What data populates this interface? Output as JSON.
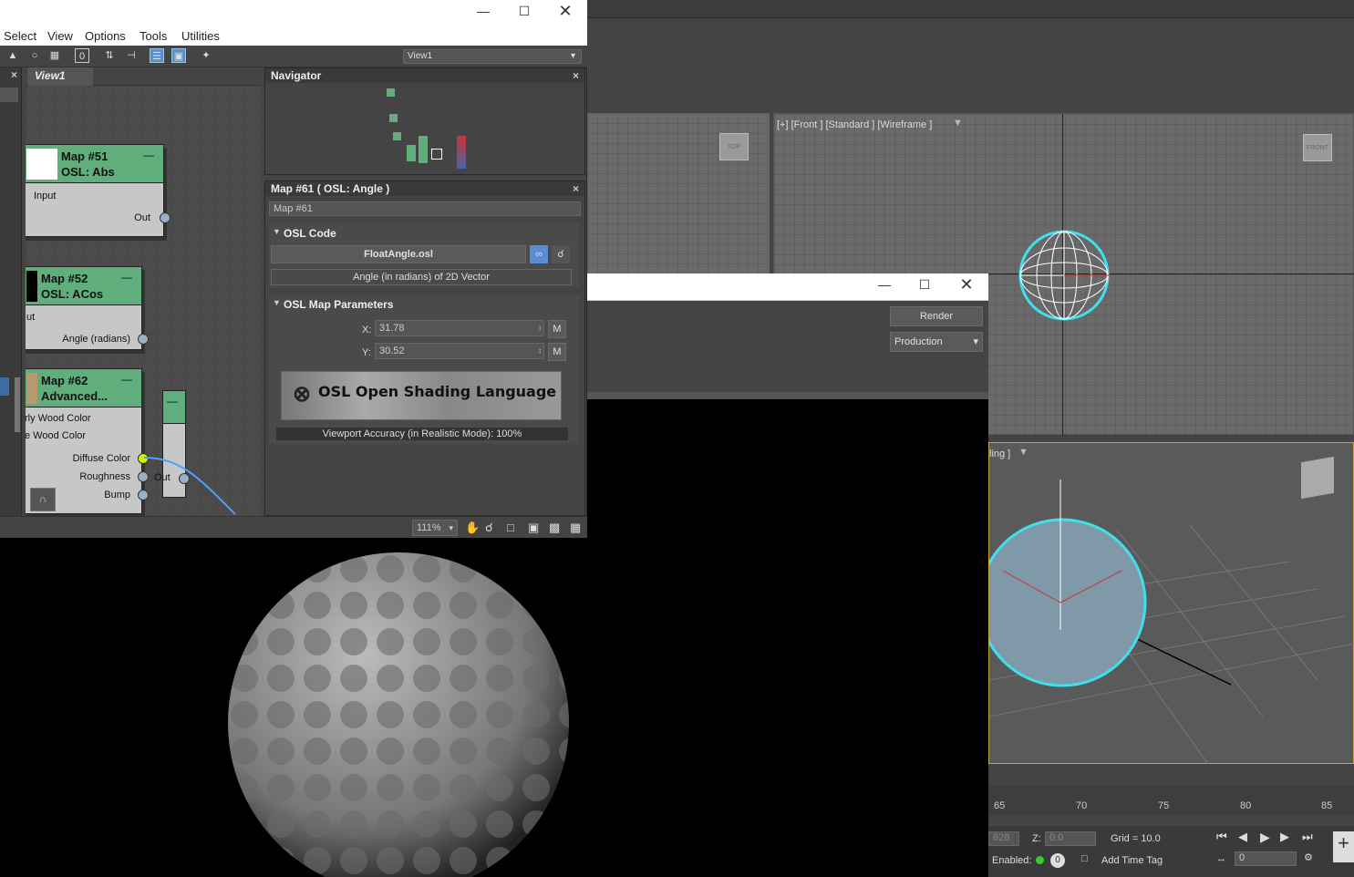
{
  "slate": {
    "menu": [
      "Select",
      "View",
      "Options",
      "Tools",
      "Utilities"
    ],
    "view_select": "View1",
    "view_tab": "View1",
    "zoom": "111%",
    "nodes": [
      {
        "title1": "Map #51",
        "title2": "OSL: Abs",
        "ports": [
          "Input"
        ],
        "out": "Out"
      },
      {
        "title1": "Map #52",
        "title2": "OSL: ACos",
        "ports": [
          "ut"
        ],
        "out": "Angle (radians)"
      },
      {
        "title1": "Map #62",
        "title2": "Advanced...",
        "ports": [
          "rly Wood Color",
          "e Wood Color",
          "Diffuse Color",
          "Roughness",
          "Bump"
        ],
        "out": "Out"
      }
    ]
  },
  "navigator": {
    "title": "Navigator"
  },
  "params": {
    "title": "Map #61  ( OSL: Angle )",
    "name": "Map #61",
    "osl_code_label": "OSL Code",
    "file": "FloatAngle.osl",
    "description": "Angle (in radians) of 2D Vector",
    "map_params_label": "OSL Map Parameters",
    "x_label": "X:",
    "x_value": "31.78",
    "y_label": "Y:",
    "y_value": "30.52",
    "m_label": "M",
    "logo_text": "OSL Open Shading Language",
    "viewport_accuracy": "Viewport Accuracy (in Realistic Mode): 100%"
  },
  "render_frame": {
    "render_button": "Render",
    "preset": "Production"
  },
  "viewports": {
    "front_label": "[+] [Front ] [Standard ] [Wireframe ]",
    "persp_label": "ling ]",
    "top_cube": "TOP",
    "front_cube": "FRONT"
  },
  "timeline": {
    "ticks": [
      "65",
      "70",
      "75",
      "80",
      "85"
    ]
  },
  "status": {
    "z_label": "Z:",
    "z_value": "0.0",
    "x_partial": "628",
    "grid": "Grid = 10.0",
    "enabled": "Enabled:",
    "add_time_tag": "Add Time Tag",
    "frame": "0",
    "key_count": "0"
  }
}
